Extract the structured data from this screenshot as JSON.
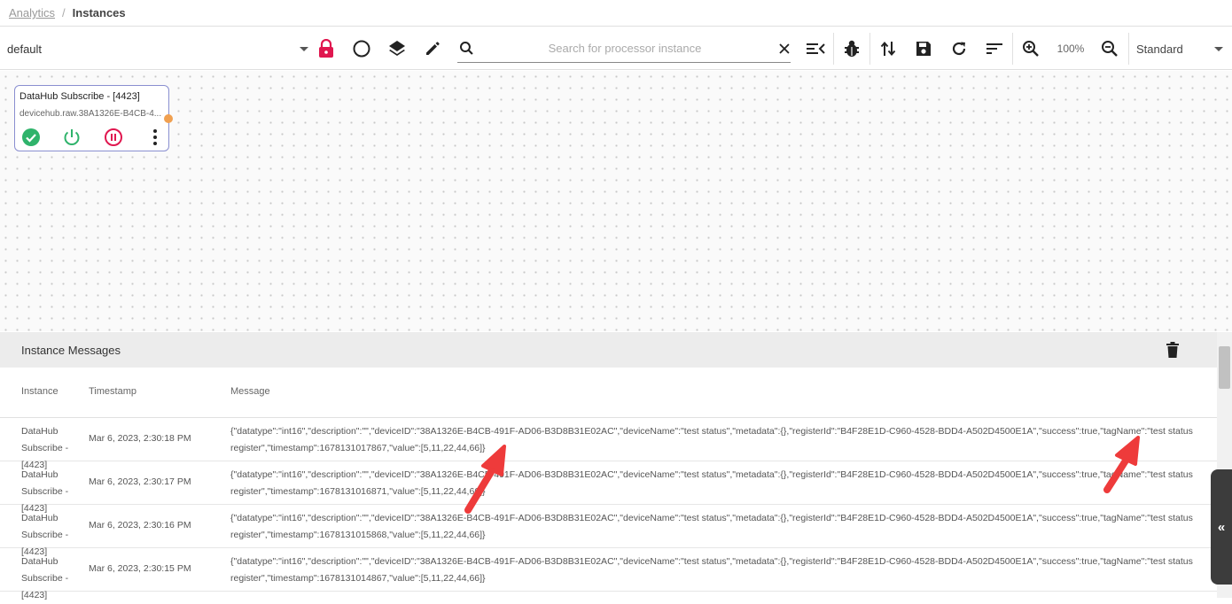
{
  "breadcrumb": {
    "parent": "Analytics",
    "separator": "/",
    "current": "Instances"
  },
  "toolbar": {
    "flow_select": "default",
    "search_placeholder": "Search for processor instance",
    "zoom": "100%",
    "view_select": "Standard",
    "icons": [
      "lock-icon",
      "circle-icon",
      "layers-icon",
      "pencil-icon",
      "search-icon",
      "close-icon",
      "collapse-list-icon",
      "bug-icon",
      "swap-vertical-icon",
      "save-icon",
      "refresh-icon",
      "sort-icon",
      "zoom-in-icon",
      "zoom-out-icon"
    ],
    "accent_lock": "#e0174f"
  },
  "node": {
    "title": "DataHub Subscribe - [4423]",
    "topic": "devicehub.raw.38A1326E-B4CB-4...",
    "status_colors": {
      "ok": "#2fb36b",
      "power": "#2fb36b",
      "pause": "#e0174f",
      "port": "#f0a050"
    }
  },
  "messages": {
    "title": "Instance Messages",
    "columns": {
      "instance": "Instance",
      "timestamp": "Timestamp",
      "message": "Message"
    },
    "rows": [
      {
        "instance": "DataHub Subscribe - [4423]",
        "timestamp": "Mar 6, 2023, 2:30:18 PM",
        "message": "{\"datatype\":\"int16\",\"description\":\"\",\"deviceID\":\"38A1326E-B4CB-491F-AD06-B3D8B31E02AC\",\"deviceName\":\"test status\",\"metadata\":{},\"registerId\":\"B4F28E1D-C960-4528-BDD4-A502D4500E1A\",\"success\":true,\"tagName\":\"test status register\",\"timestamp\":1678131017867,\"value\":[5,11,22,44,66]}"
      },
      {
        "instance": "DataHub Subscribe - [4423]",
        "timestamp": "Mar 6, 2023, 2:30:17 PM",
        "message": "{\"datatype\":\"int16\",\"description\":\"\",\"deviceID\":\"38A1326E-B4CB-491F-AD06-B3D8B31E02AC\",\"deviceName\":\"test status\",\"metadata\":{},\"registerId\":\"B4F28E1D-C960-4528-BDD4-A502D4500E1A\",\"success\":true,\"tagName\":\"test status register\",\"timestamp\":1678131016871,\"value\":[5,11,22,44,66]}"
      },
      {
        "instance": "DataHub Subscribe - [4423]",
        "timestamp": "Mar 6, 2023, 2:30:16 PM",
        "message": "{\"datatype\":\"int16\",\"description\":\"\",\"deviceID\":\"38A1326E-B4CB-491F-AD06-B3D8B31E02AC\",\"deviceName\":\"test status\",\"metadata\":{},\"registerId\":\"B4F28E1D-C960-4528-BDD4-A502D4500E1A\",\"success\":true,\"tagName\":\"test status register\",\"timestamp\":1678131015868,\"value\":[5,11,22,44,66]}"
      },
      {
        "instance": "DataHub Subscribe - [4423]",
        "timestamp": "Mar 6, 2023, 2:30:15 PM",
        "message": "{\"datatype\":\"int16\",\"description\":\"\",\"deviceID\":\"38A1326E-B4CB-491F-AD06-B3D8B31E02AC\",\"deviceName\":\"test status\",\"metadata\":{},\"registerId\":\"B4F28E1D-C960-4528-BDD4-A502D4500E1A\",\"success\":true,\"tagName\":\"test status register\",\"timestamp\":1678131014867,\"value\":[5,11,22,44,66]}"
      }
    ]
  },
  "side_toggle": "«",
  "annotation_color": "#ee3b3b"
}
